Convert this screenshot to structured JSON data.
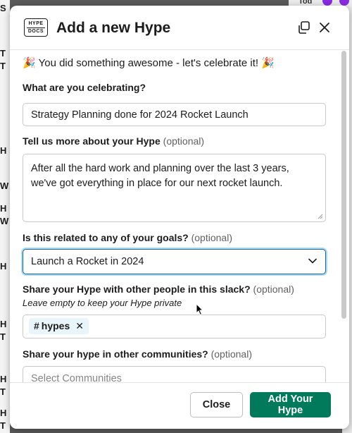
{
  "background": {
    "left_letters": [
      "S",
      "T",
      "T",
      "H",
      "W",
      "H",
      "W",
      "H",
      "H",
      "T",
      "H",
      "T",
      "H",
      "T"
    ],
    "top_right_text": "Tod"
  },
  "modal": {
    "logo_line1": "HYPE",
    "logo_line2": "DOCS",
    "title": "Add a new Hype",
    "intro": "You did something awesome - let's celebrate it!",
    "celebrate": {
      "label": "What are you celebrating?",
      "value": "Strategy Planning done for 2024 Rocket Launch"
    },
    "details": {
      "label": "Tell us more about your Hype",
      "optional": "(optional)",
      "value": "After all the hard work and planning over the last 3 years, we've got everything in place for our next rocket launch."
    },
    "goals": {
      "label": "Is this related to any of your goals?",
      "optional": "(optional)",
      "selected": "Launch a Rocket in 2024"
    },
    "share": {
      "label": "Share your Hype with other people in this slack?",
      "optional": "(optional)",
      "hint": "Leave empty to keep your Hype private",
      "chip_hash": "#",
      "chip_label": "hypes"
    },
    "communities": {
      "label": "Share your hype in other communities?",
      "optional": "(optional)",
      "placeholder": "Select Communities"
    },
    "buttons": {
      "close": "Close",
      "add": "Add Your Hype"
    }
  },
  "colors": {
    "primary_button": "#007a5a",
    "focus_border": "#1264a3",
    "chip_bg": "#e8f5fa"
  }
}
